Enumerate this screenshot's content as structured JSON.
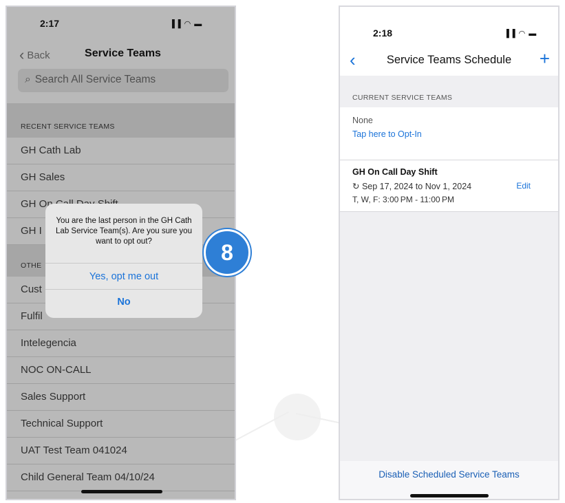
{
  "left_screen": {
    "status_time": "2:17",
    "status_icons": "▐▐ ◠ ▬",
    "nav": {
      "back_label": "Back",
      "back_chevron": "‹",
      "title": "Service Teams"
    },
    "search": {
      "icon": "⌕",
      "placeholder": "Search All Service Teams"
    },
    "recent_header": "RECENT SERVICE TEAMS",
    "recent_items": [
      "GH Cath Lab",
      "GH Sales",
      "GH On Call Day Shift",
      "GH I"
    ],
    "other_header": "OTHE",
    "other_items": [
      "Cust",
      "Fulfil",
      "Intelegencia",
      "NOC ON-CALL",
      "Sales Support",
      "Technical Support",
      "UAT Test Team 041024",
      "Child General Team 04/10/24"
    ]
  },
  "alert": {
    "message": "You are the last person in the GH Cath Lab Service Team(s). Are you sure you want to opt out?",
    "confirm_label": "Yes, opt me out",
    "cancel_label": "No"
  },
  "step_badge": "8",
  "right_screen": {
    "status_time": "2:18",
    "status_icons": "▐▐ ◠ ▬",
    "nav": {
      "back_chevron": "‹",
      "title": "Service Teams Schedule",
      "add_icon": "+"
    },
    "current_header": "CURRENT SERVICE TEAMS",
    "current_value": "None",
    "opt_in_link": "Tap here to Opt-In",
    "schedule": {
      "name": "GH On Call Day Shift",
      "dates": "↻ Sep 17, 2024 to Nov 1, 2024",
      "days": "T, W, F: 3:00 PM - 11:00 PM",
      "edit_label": "Edit"
    },
    "disable_button": "Disable Scheduled Service Teams"
  }
}
